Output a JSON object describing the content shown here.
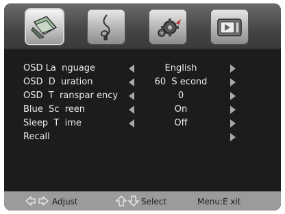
{
  "tabs": [
    {
      "name": "picture",
      "icon": "picture-icon",
      "active": true
    },
    {
      "name": "audio",
      "icon": "music-note-icon",
      "active": false
    },
    {
      "name": "settings",
      "icon": "gear-icon",
      "active": false
    },
    {
      "name": "tv",
      "icon": "tv-icon",
      "active": false
    }
  ],
  "menu": [
    {
      "label": "OSD La  nguage",
      "value": "English"
    },
    {
      "label": "OSD  D  uration",
      "value": "60  S econd"
    },
    {
      "label": "OSD  T  ranspar ency",
      "value": "0"
    },
    {
      "label": "Blue  Sc  reen",
      "value": "On"
    },
    {
      "label": "Sleep  T  ime",
      "value": "Off"
    },
    {
      "label": "Recall",
      "value": ""
    }
  ],
  "footer": {
    "adjust_label": "Adjust",
    "select_label": "Select",
    "menu_label": "Menu:E xit"
  },
  "colors": {
    "panel": "#1c1c1c",
    "footer": "#9b9b9b",
    "arrow": "#a8a8a8",
    "text": "#ececec"
  }
}
